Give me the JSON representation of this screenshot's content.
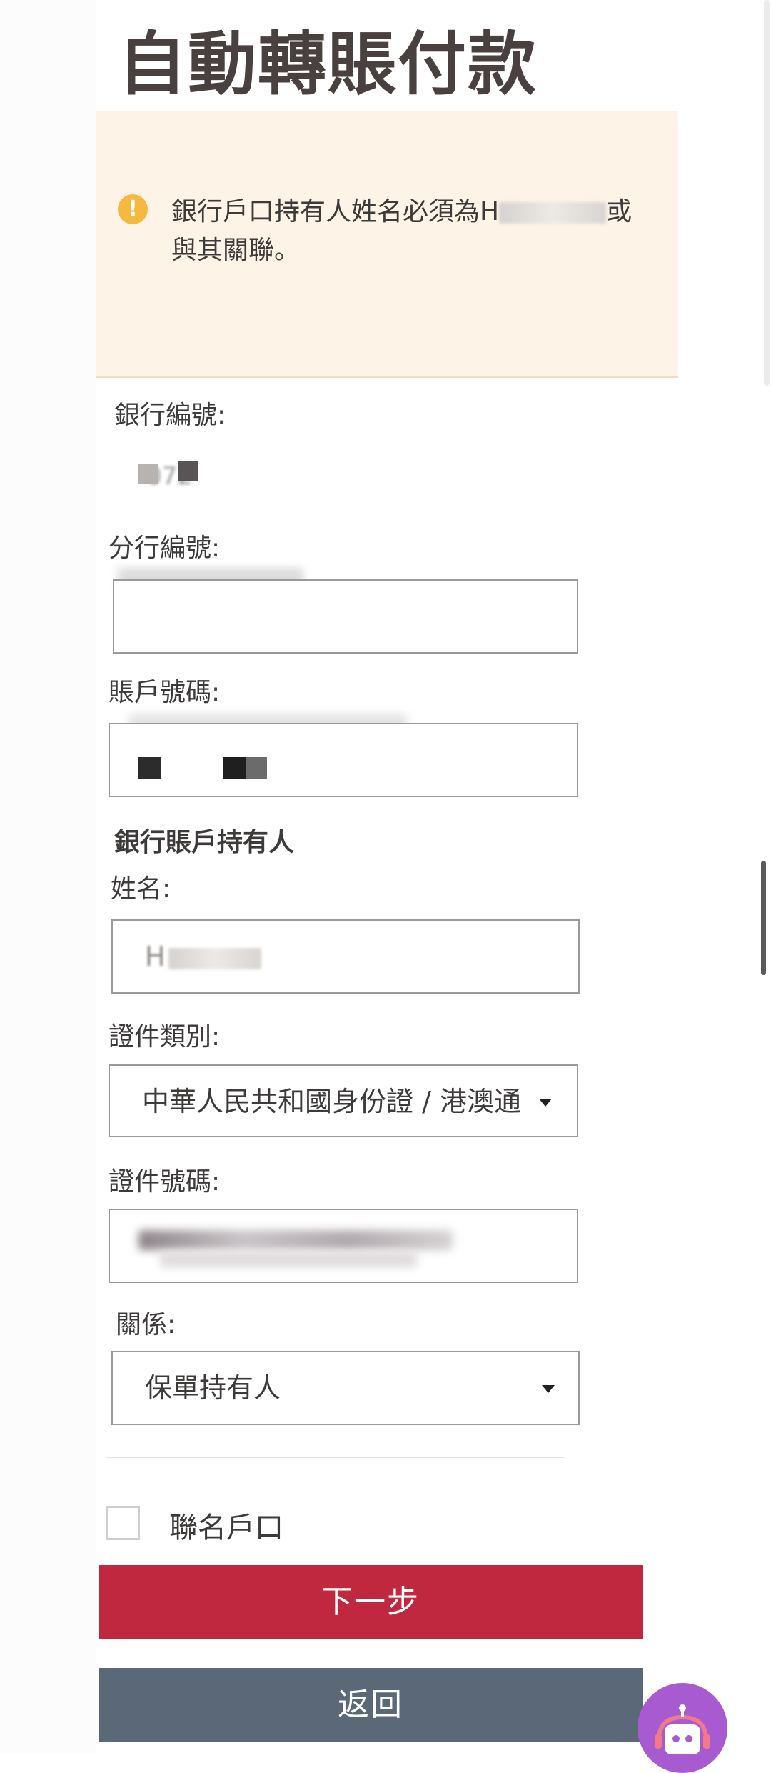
{
  "page": {
    "title": "自動轉賬付款"
  },
  "notice": {
    "icon": "exclamation-circle-icon",
    "text_before": "銀行戶口持有人姓名必須為H",
    "text_after": "或與其關聯。"
  },
  "bank": {
    "bank_code_label": "銀行編號:",
    "bank_code_value": "072",
    "branch_code_label": "分行編號:",
    "branch_code_value": "",
    "account_number_label": "賬戶號碼:"
  },
  "holder": {
    "section_title": "銀行賬戶持有人",
    "name_label": "姓名:",
    "name_value": "H",
    "id_type_label": "證件類別:",
    "id_type_value": "中華人民共和國身份證 / 港澳通",
    "id_number_label": "證件號碼:",
    "relationship_label": "關係:",
    "relationship_value": "保單持有人"
  },
  "joint_account": {
    "label": "聯名戶口",
    "checked": false
  },
  "buttons": {
    "next_label": "下一步",
    "back_label": "返回"
  },
  "colors": {
    "primary": "#c0283f",
    "secondary": "#5a6878",
    "notice_bg": "#fdf3e6",
    "notice_icon": "#f5b942",
    "chatbot": "#a85ad0"
  }
}
